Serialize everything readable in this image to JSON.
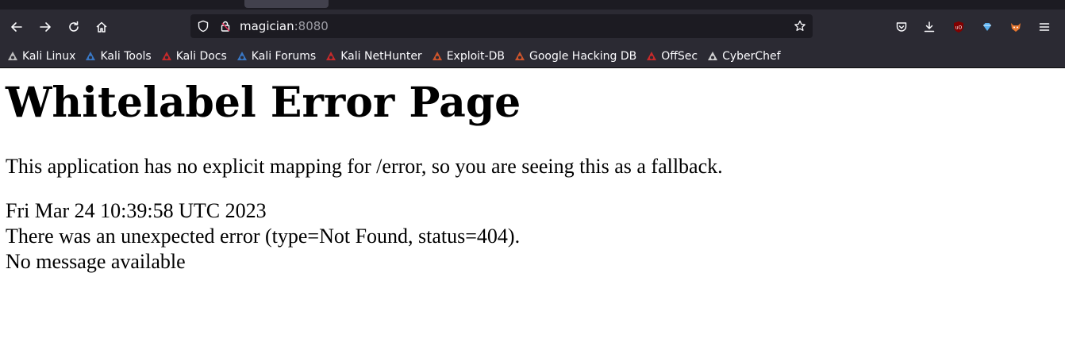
{
  "browser": {
    "url_host": "magician",
    "url_port": ":8080"
  },
  "bookmarks": [
    {
      "label": "Kali Linux",
      "icon": "kali-dragon-icon",
      "color": "#cccccc"
    },
    {
      "label": "Kali Tools",
      "icon": "kali-tools-icon",
      "color": "#3b7fd4"
    },
    {
      "label": "Kali Docs",
      "icon": "kali-docs-icon",
      "color": "#d62a2a"
    },
    {
      "label": "Kali Forums",
      "icon": "kali-forums-icon",
      "color": "#3b7fd4"
    },
    {
      "label": "Kali NetHunter",
      "icon": "kali-nethunter-icon",
      "color": "#d62a2a"
    },
    {
      "label": "Exploit-DB",
      "icon": "exploit-db-icon",
      "color": "#e05a2b"
    },
    {
      "label": "Google Hacking DB",
      "icon": "ghdb-icon",
      "color": "#e05a2b"
    },
    {
      "label": "OffSec",
      "icon": "offsec-icon",
      "color": "#d62a2a"
    },
    {
      "label": "CyberChef",
      "icon": "cyberchef-icon",
      "color": "#e0e0e0"
    }
  ],
  "page": {
    "title": "Whitelabel Error Page",
    "message": "This application has no explicit mapping for /error, so you are seeing this as a fallback.",
    "timestamp": "Fri Mar 24 10:39:58 UTC 2023",
    "error_line": "There was an unexpected error (type=Not Found, status=404).",
    "detail": "No message available"
  }
}
